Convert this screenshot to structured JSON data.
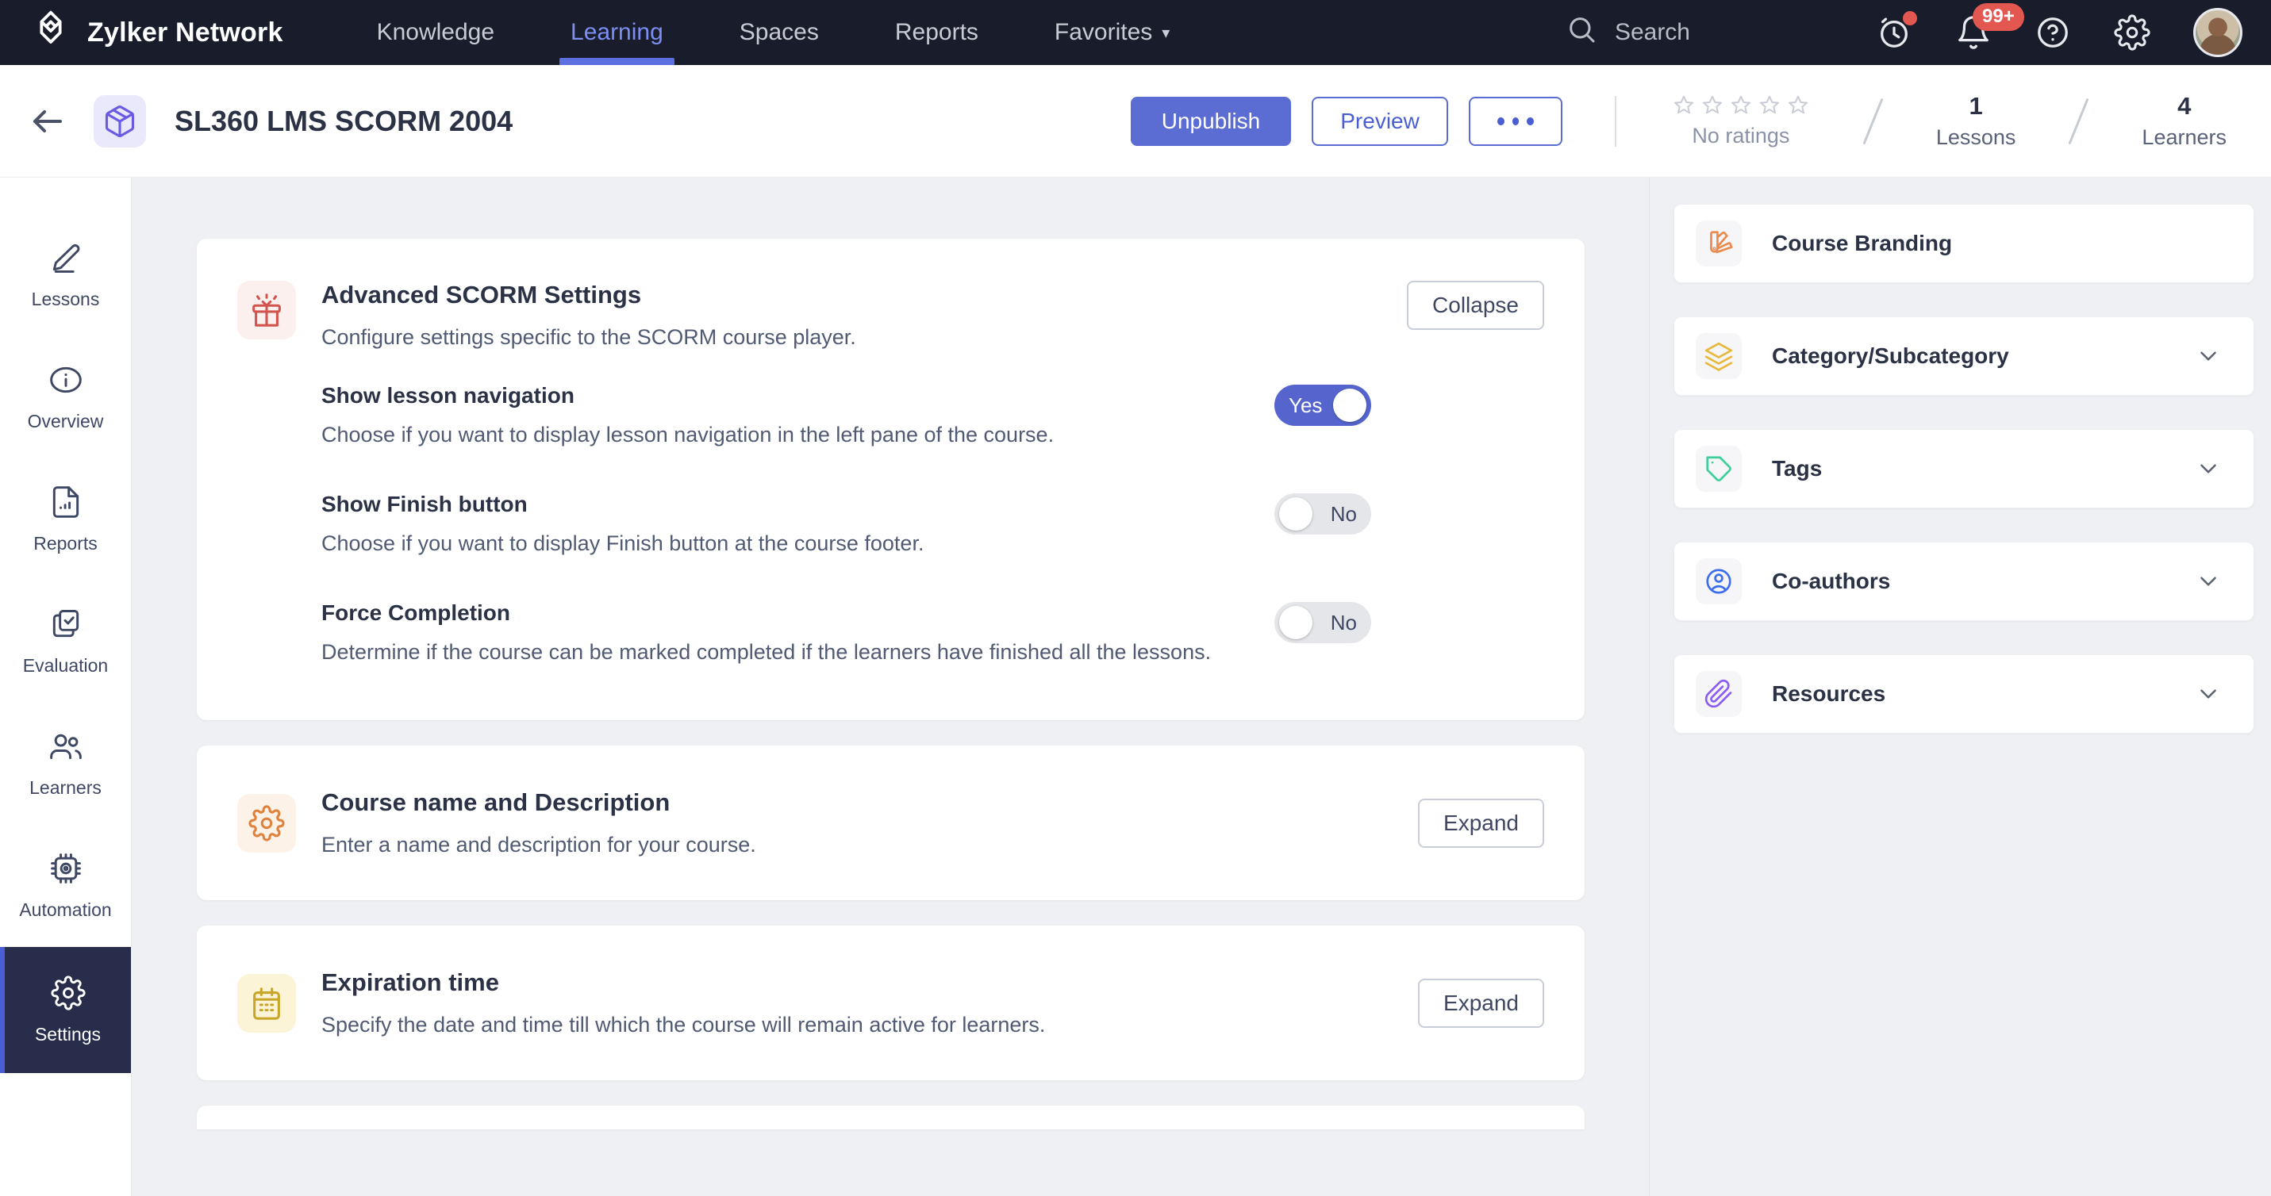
{
  "topnav": {
    "brand": "Zylker Network",
    "items": [
      {
        "label": "Knowledge"
      },
      {
        "label": "Learning"
      },
      {
        "label": "Spaces"
      },
      {
        "label": "Reports"
      },
      {
        "label": "Favorites"
      }
    ],
    "search_label": "Search",
    "notification_badge": "99+"
  },
  "header": {
    "title": "SL360 LMS SCORM 2004",
    "unpublish_label": "Unpublish",
    "preview_label": "Preview",
    "rating_label": "No ratings",
    "stats": [
      {
        "value": "1",
        "label": "Lessons"
      },
      {
        "value": "4",
        "label": "Learners"
      }
    ]
  },
  "sidebar": {
    "items": [
      {
        "label": "Lessons"
      },
      {
        "label": "Overview"
      },
      {
        "label": "Reports"
      },
      {
        "label": "Evaluation"
      },
      {
        "label": "Learners"
      },
      {
        "label": "Automation"
      },
      {
        "label": "Settings",
        "selected": true
      }
    ]
  },
  "main": {
    "cards": [
      {
        "title": "Advanced SCORM Settings",
        "subtitle": "Configure settings specific to the SCORM course player.",
        "action_label": "Collapse",
        "settings": [
          {
            "title": "Show lesson navigation",
            "description": "Choose if you want to display lesson navigation in the left pane of the course.",
            "state": "Yes"
          },
          {
            "title": "Show Finish button",
            "description": "Choose if you want to display Finish button at the course footer.",
            "state": "No"
          },
          {
            "title": "Force Completion",
            "description": "Determine if the course can be marked completed if the learners have finished all the lessons.",
            "state": "No"
          }
        ]
      },
      {
        "title": "Course name and Description",
        "subtitle": "Enter a name and description for your course.",
        "action_label": "Expand"
      },
      {
        "title": "Expiration time",
        "subtitle": "Specify the date and time till which the course will remain active for learners.",
        "action_label": "Expand"
      }
    ]
  },
  "right_panel": {
    "cards": [
      {
        "label": "Course Branding"
      },
      {
        "label": "Category/Subcategory"
      },
      {
        "label": "Tags"
      },
      {
        "label": "Co-authors"
      },
      {
        "label": "Resources"
      }
    ]
  },
  "colors": {
    "accent": "#5b6cd2",
    "toggle_on": "#5565cd",
    "nav_active": "#7d8ef2",
    "badge_red": "#e2574f",
    "selected_nav_bg": "#272d4a",
    "icon_red": "#d2544f",
    "icon_orange": "#e0813c",
    "icon_yellow": "#c9a62a",
    "branding_orange": "#e98a4e",
    "category_yellow": "#e8b93c",
    "tag_green": "#3ecf9a",
    "coauthor_blue": "#3d6ef0",
    "resource_purple": "#8b5cf6"
  }
}
